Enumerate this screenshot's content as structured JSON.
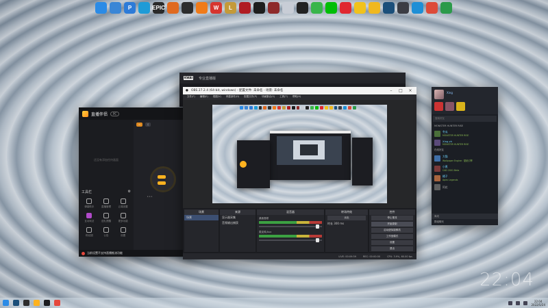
{
  "dock": {
    "icons": [
      {
        "name": "windows-icon",
        "label": "",
        "color": "#2b8be6"
      },
      {
        "name": "bird-icon",
        "label": "",
        "color": "#3a86d6"
      },
      {
        "name": "p-icon",
        "label": "P",
        "color": "#2d7bd8"
      },
      {
        "name": "ring-icon",
        "label": "",
        "color": "#1e9bd7"
      },
      {
        "name": "epic-icon",
        "label": "EPIC",
        "color": "#2a2a2a"
      },
      {
        "name": "blitz-icon",
        "label": "",
        "color": "#e06a20"
      },
      {
        "name": "obs-icon",
        "label": "",
        "color": "#2d2d2d"
      },
      {
        "name": "flame-icon",
        "label": "",
        "color": "#f07b1a"
      },
      {
        "name": "wps-icon",
        "label": "W",
        "color": "#d7352f"
      },
      {
        "name": "league-icon",
        "label": "L",
        "color": "#c49a39"
      },
      {
        "name": "game-icon",
        "label": "",
        "color": "#b01c22"
      },
      {
        "name": "clock-icon",
        "label": "",
        "color": "#1e1e1e"
      },
      {
        "name": "sword-icon",
        "label": "",
        "color": "#8e2a2a"
      },
      {
        "name": "tag-icon",
        "label": "",
        "color": "#c8cdd6"
      },
      {
        "name": "penguin-icon",
        "label": "",
        "color": "#222222"
      },
      {
        "name": "wechat-icon",
        "label": "",
        "color": "#39b54a"
      },
      {
        "name": "iqiyi-icon",
        "label": "",
        "color": "#00be06"
      },
      {
        "name": "netease-music-icon",
        "label": "",
        "color": "#e0282f"
      },
      {
        "name": "qq-music-icon",
        "label": "",
        "color": "#f1c21b"
      },
      {
        "name": "glasses-icon",
        "label": "",
        "color": "#f0b81f"
      },
      {
        "name": "steam-icon",
        "label": "",
        "color": "#1b4f7a"
      },
      {
        "name": "monitor-icon",
        "label": "",
        "color": "#3b3d44"
      },
      {
        "name": "edge-icon",
        "label": "",
        "color": "#1e8fd6"
      },
      {
        "name": "chrome-icon",
        "label": "",
        "color": "#dd4b39"
      },
      {
        "name": "leaf-icon",
        "label": "",
        "color": "#2c9a4a"
      }
    ]
  },
  "live_app": {
    "title": "直播伴侣",
    "empty_hint": "还没有添加任何画面",
    "tools_title": "工具栏",
    "tools": [
      "弹幕助手",
      "直播管理",
      "云端设置",
      "互动玩法",
      "送礼提醒",
      "更多功能",
      "粉丝团",
      "公告",
      "设置"
    ],
    "footer": "当前设置不支持直播推流功能"
  },
  "back_window": {
    "title": "专业直播版"
  },
  "obs": {
    "title": "OBS 27.2.4 (64-bit, windows) - 配置文件: 未命名 - 场景: 未命名",
    "menu": [
      "文件(F)",
      "编辑(E)",
      "视图(V)",
      "停靠部件(D)",
      "配置文件(P)",
      "场景集合(S)",
      "工具(T)",
      "帮助(H)"
    ],
    "panels": {
      "scenes": "场景",
      "scene_item": "场景",
      "sources": "来源",
      "source_items": [
        "显示器采集",
        "音频输出捕获"
      ],
      "mixer": "混音器",
      "mixer_lines": [
        "桌面音频",
        "麦克风/Aux"
      ],
      "transitions": "转场特效",
      "transition_value": "淡出",
      "duration_label": "时长",
      "duration_value": "300 ms",
      "controls": "控件",
      "control_buttons": [
        "停止推流",
        "开始录制",
        "启动虚拟摄像机",
        "工作室模式",
        "设置",
        "退出"
      ]
    },
    "status": [
      "LIVE: 00:09:59",
      "REC: 00:00:00",
      "CPU: 3.9%, 60.00 fps"
    ]
  },
  "steam": {
    "username": "Xing",
    "search_placeholder": "搜索好友",
    "group_ingame": "MONSTER HUNTER RISE",
    "group_online": "在线好友",
    "friends": [
      {
        "name": "冬瓜",
        "status": "MONSTER HUNTER RISE",
        "color": "#4a6f3a",
        "offline": false
      },
      {
        "name": "Xing.zh",
        "status": "MONSTER HUNTER RISE",
        "color": "#5a4a7a",
        "offline": false
      },
      {
        "name": "大猫",
        "status": "Wallpaper Engine：壁纸引擎",
        "color": "#3f6fa8",
        "offline": false
      },
      {
        "name": "小黑",
        "status": "CAD 2001 Beta",
        "color": "#7a3a3a",
        "offline": false
      },
      {
        "name": "橘子",
        "status": "Apex Legends",
        "color": "#a8653f",
        "offline": false
      },
      {
        "name": "阿花",
        "status": "",
        "color": "#5f5f5f",
        "offline": true
      }
    ],
    "group_offline": "离线",
    "chat_label": "群组聊天"
  },
  "clock": "22:04",
  "taskbar": {
    "time": "22:04",
    "date": "2022/5/24"
  }
}
